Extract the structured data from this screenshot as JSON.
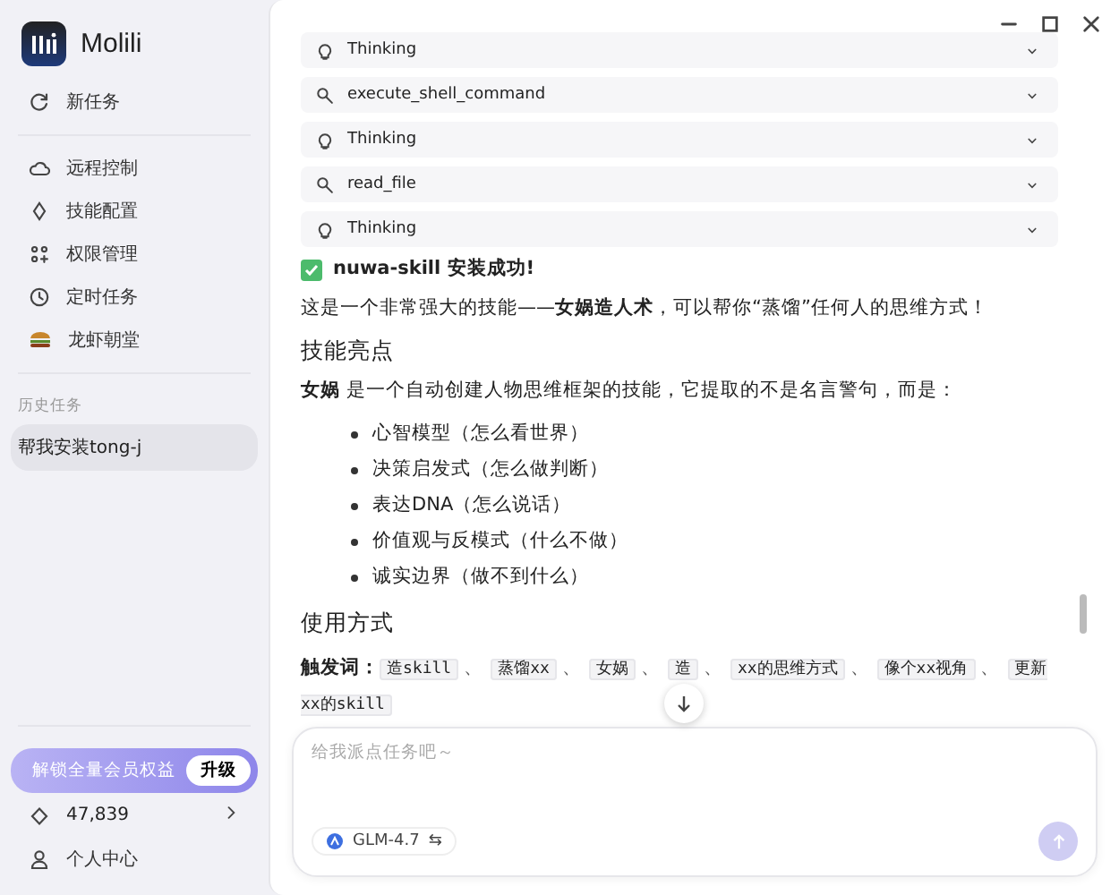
{
  "app": {
    "name": "Molili"
  },
  "sidebar": {
    "new_task": "新任务",
    "menu": [
      {
        "label": "远程控制"
      },
      {
        "label": "技能配置"
      },
      {
        "label": "权限管理"
      },
      {
        "label": "定时任务"
      },
      {
        "label": "龙虾朝堂"
      }
    ],
    "history_heading": "历史任务",
    "history": [
      {
        "label": "帮我安装tong-j",
        "selected": true
      }
    ],
    "promo": {
      "text": "解锁全量会员权益",
      "button": "升级"
    },
    "credits": "47,839",
    "profile": "个人中心"
  },
  "chat": {
    "steps": [
      {
        "kind": "thinking",
        "label": "Thinking"
      },
      {
        "kind": "tool",
        "label": "execute_shell_command"
      },
      {
        "kind": "thinking",
        "label": "Thinking"
      },
      {
        "kind": "tool",
        "label": "read_file"
      },
      {
        "kind": "thinking",
        "label": "Thinking"
      }
    ],
    "success": "nuwa-skill 安装成功!",
    "intro": "这是一个非常强大的技能——**女娲造人术**，可以帮你“蒸馏”任何人的思维方式！",
    "highlights_heading": "技能亮点",
    "highlights_intro": "**女娲** 是一个自动创建人物思维框架的技能，它提取的不是名言警句，而是：",
    "bullets": [
      "心智模型（怎么看世界）",
      "决策启发式（怎么做判断）",
      "表达DNA（怎么说话）",
      "价值观与反模式（什么不做）",
      "诚实边界（做不到什么）"
    ],
    "usage_heading": "使用方式",
    "trigger_label": "触发词：",
    "separator": "、",
    "triggers": [
      "造skill",
      "蒸馏xx",
      "女娲",
      "造",
      "xx的思维方式",
      "像个xx视角",
      "更新xx的skill"
    ]
  },
  "composer": {
    "placeholder": "给我派点任务吧～",
    "model": "GLM-4.7",
    "switch_glyph": "⇆"
  }
}
